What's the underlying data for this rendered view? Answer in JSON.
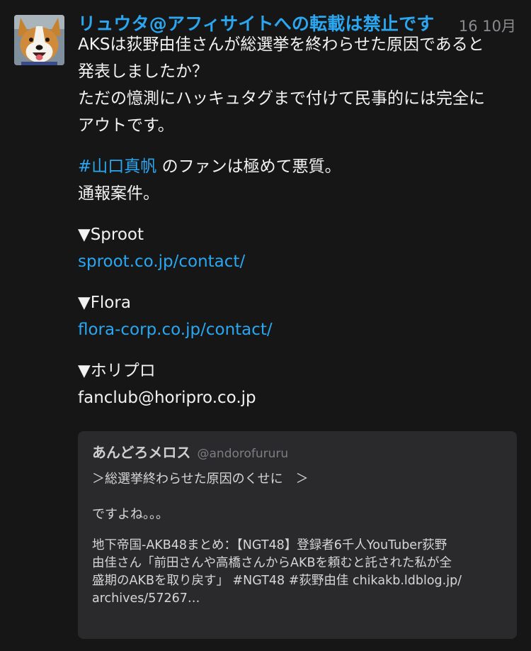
{
  "tweet": {
    "display_name": "リュウタ@アフィサイトへの転載は禁止です",
    "timestamp": "16 10月",
    "body_lines": [
      "AKSは荻野由佳さんが総選挙を終わらせた原因であると",
      "発表しましたか？",
      "ただの憶測にハッキュタグまで付けて民事的には完全に",
      "アウトです。"
    ],
    "hashtag": "#山口真帆",
    "hashtag_suffix": " のファンは極めて悪質。",
    "report_line": "通報案件。",
    "contacts": [
      {
        "label": "▼Sproot",
        "value": "sproot.co.jp/contact/"
      },
      {
        "label": "▼Flora",
        "value": "flora-corp.co.jp/contact/"
      },
      {
        "label": "▼ホリプロ",
        "value": "fanclub@horipro.co.jp"
      }
    ]
  },
  "quote": {
    "name": "あんどろメロス",
    "handle": "@andorofururu",
    "line1": "＞総選挙終わらせた原因のくせに　＞",
    "line2": "ですよね。。。",
    "source_lines": [
      "地下帝国-AKB48まとめ：【NGT48】登録者6千人YouTuber荻野",
      "由佳さん「前田さんや高橋さんからAKBを頼むと託された私が全",
      "盛期のAKBを取り戻す」 #NGT48 #荻野由佳 chikakb.ldblog.jp/",
      "archives/57267…"
    ]
  }
}
